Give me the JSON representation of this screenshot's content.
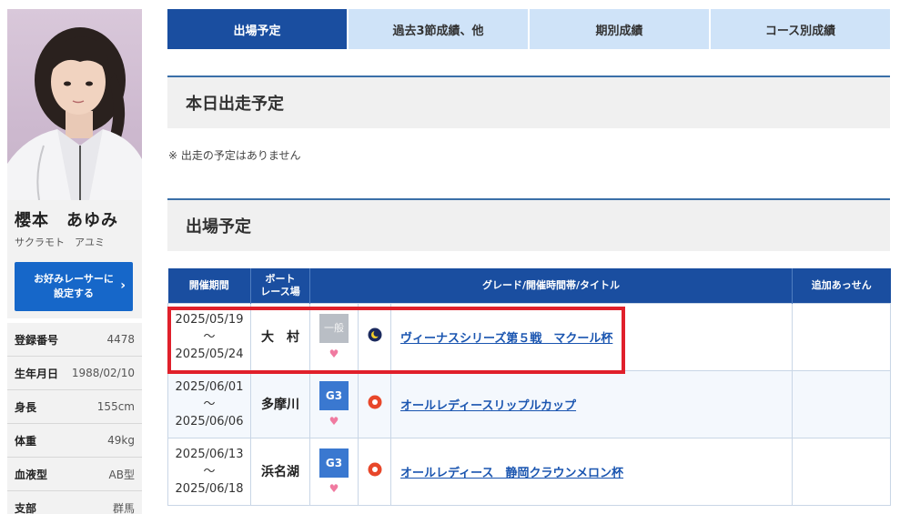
{
  "profile": {
    "name": "櫻本　あゆみ",
    "kana": "サクラモト　アユミ",
    "fav_button_line1": "お好みレーサーに",
    "fav_button_line2": "設定する",
    "fav_arrow": "›",
    "info": [
      {
        "label": "登録番号",
        "value": "4478"
      },
      {
        "label": "生年月日",
        "value": "1988/02/10"
      },
      {
        "label": "身長",
        "value": "155cm"
      },
      {
        "label": "体重",
        "value": "49kg"
      },
      {
        "label": "血液型",
        "value": "AB型"
      },
      {
        "label": "支部",
        "value": "群馬"
      }
    ]
  },
  "tabs": [
    {
      "label": "出場予定",
      "active": true
    },
    {
      "label": "過去3節成績、他",
      "active": false
    },
    {
      "label": "期別成績",
      "active": false
    },
    {
      "label": "コース別成績",
      "active": false
    }
  ],
  "today": {
    "title": "本日出走予定",
    "note": "※ 出走の予定はありません"
  },
  "schedule": {
    "title": "出場予定",
    "headers": {
      "period": "開催期間",
      "venue_line1": "ボート",
      "venue_line2": "レース場",
      "grade": "グレード/開催時間帯/タイトル",
      "extra": "追加あっせん"
    },
    "rows": [
      {
        "start": "2025/05/19",
        "tilde": "～",
        "end": "2025/05/24",
        "venue": "大　村",
        "grade": "一般",
        "heart": "♥",
        "time_icon": "night",
        "title": "ヴィーナスシリーズ第５戦　マクール杯",
        "extra": ""
      },
      {
        "start": "2025/06/01",
        "tilde": "～",
        "end": "2025/06/06",
        "venue": "多摩川",
        "grade": "G3",
        "heart": "♥",
        "time_icon": "day",
        "title": "オールレディースリップルカップ",
        "extra": ""
      },
      {
        "start": "2025/06/13",
        "tilde": "～",
        "end": "2025/06/18",
        "venue": "浜名湖",
        "grade": "G3",
        "heart": "♥",
        "time_icon": "day",
        "title": "オールレディース　静岡クラウンメロン杯",
        "extra": ""
      }
    ]
  },
  "colors": {
    "active_tab": "#1a4ea0",
    "inactive_tab": "#cfe3f8",
    "link": "#1a55b0",
    "highlight": "#e0202b",
    "heart": "#f07aa0",
    "g3_badge": "#3a78d0"
  }
}
